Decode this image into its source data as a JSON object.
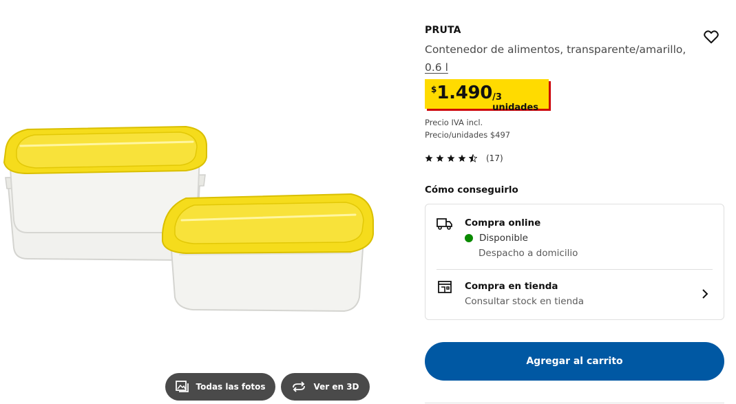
{
  "product": {
    "name": "PRUTA",
    "description": "Contenedor de alimentos, transparente/amarillo,",
    "size": "0.6 l"
  },
  "price": {
    "currency": "$",
    "amount": "1.490",
    "unit": "/3 unidades",
    "vat_note": "Precio IVA incl.",
    "unit_price": "Precio/unidades $497"
  },
  "rating": {
    "stars": 4.5,
    "count": "(17)"
  },
  "availability": {
    "heading": "Cómo conseguirlo",
    "online": {
      "title": "Compra online",
      "status": "Disponible",
      "detail": "Despacho a domicilio"
    },
    "store": {
      "title": "Compra en tienda",
      "detail": "Consultar stock en tienda"
    }
  },
  "actions": {
    "add_to_cart": "Agregar al carrito"
  },
  "gallery": {
    "all_photos": "Todas las fotos",
    "view_3d": "Ver en 3D"
  },
  "icons": {
    "wishlist": "heart-icon",
    "truck": "truck-icon",
    "store": "store-icon",
    "chevron": "chevron-right-icon",
    "photos": "gallery-icon",
    "rotate": "3d-rotate-icon"
  },
  "colors": {
    "price_bg": "#ffdb00",
    "price_shadow": "#cc0008",
    "primary": "#0058a3",
    "available": "#0a8a00",
    "gallery_btn": "#4a4a4a"
  }
}
